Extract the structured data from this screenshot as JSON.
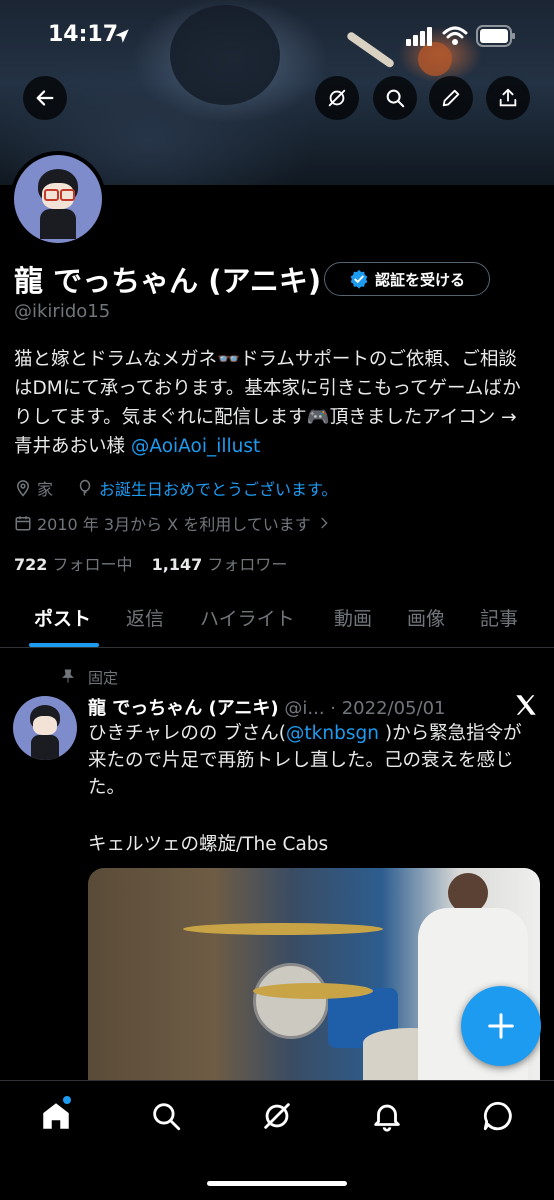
{
  "status_bar": {
    "time": "14:17"
  },
  "header": {
    "back_icon": "arrow-left-icon",
    "actions": [
      "grok-icon",
      "search-icon",
      "edit-pencil-icon",
      "share-icon"
    ]
  },
  "profile": {
    "name": "龍 でっちゃん (アニキ)",
    "handle": "@ikirido15",
    "verify_button": "認証を受ける",
    "bio_text": "猫と嫁とドラムなメガネ👓ドラムサポートのご依頼、ご相談はDMにて承っております。基本家に引きこもってゲームばかりしてます。気まぐれに配信します🎮頂きましたアイコン → 青井あおい様 ",
    "bio_link": "@AoiAoi_illust",
    "location": "家",
    "birthday_text": "お誕生日おめでとうございます。",
    "joined": "2010 年 3月から X を利用しています",
    "following_count": "722",
    "following_label": "フォロー中",
    "followers_count": "1,147",
    "followers_label": "フォロワー"
  },
  "tabs": [
    "ポスト",
    "返信",
    "ハイライト",
    "動画",
    "画像",
    "記事"
  ],
  "pinned_post": {
    "pinned_label": "固定",
    "author": "龍 でっちゃん (アニキ)",
    "handle_trunc": "@i...",
    "date": "· 2022/05/01",
    "text_before": "ひきチャレのの ブさん(",
    "mention": "@tknbsgn",
    "text_after": " )から緊急指令が来たので片足で再筋トレし直した。己の衰えを感じた。",
    "song_line": "キェルツェの螺旋/The Cabs"
  },
  "colors": {
    "accent": "#1d9bf0",
    "bg": "#000000",
    "muted": "#71767b"
  }
}
